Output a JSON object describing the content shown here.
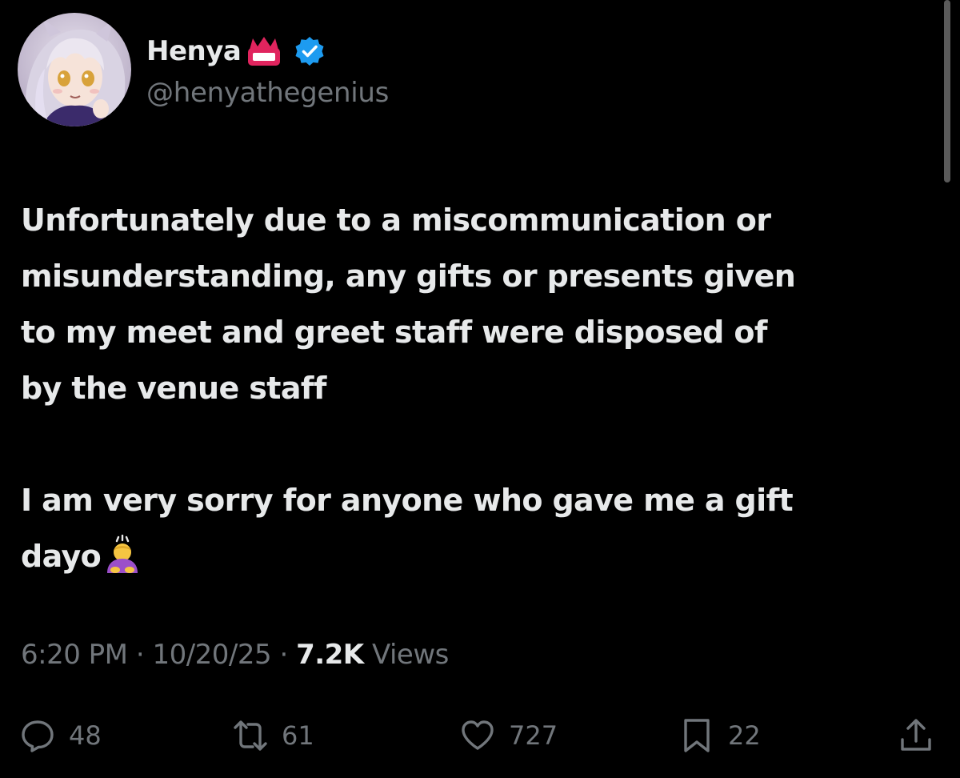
{
  "author": {
    "display_name": "Henya",
    "handle": "@henyathegenius",
    "verified": true,
    "avatar_icon": "anime-avatar-icon",
    "name_badge_icon": "crown-badge-icon"
  },
  "tweet": {
    "paragraph1_lines": [
      "Unfortunately due to a miscommunication or",
      "misunderstanding, any gifts or presents given",
      "to my meet and greet staff were disposed of",
      "by the venue staff"
    ],
    "paragraph2_lines": [
      "I am very sorry for anyone who gave me a gift",
      "dayo"
    ],
    "emoji": "person-bowing-icon"
  },
  "meta": {
    "time": "6:20 PM",
    "separator": "·",
    "date": "10/20/25",
    "views_count": "7.2K",
    "views_label": "Views"
  },
  "actions": {
    "replies": "48",
    "reposts": "61",
    "likes": "727",
    "bookmarks": "22"
  },
  "colors": {
    "background": "#000000",
    "text": "#e7e9ea",
    "secondary": "#71767b",
    "verified": "#1d9bf0",
    "badge": "#e0245e"
  }
}
